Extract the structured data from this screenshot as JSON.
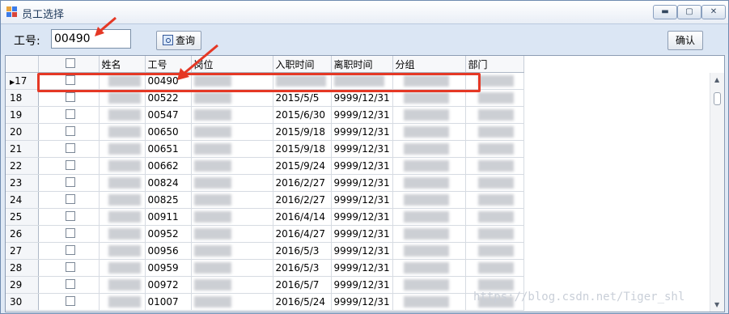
{
  "window": {
    "title": "员工选择",
    "buttons": {
      "minimize": "▬",
      "maximize": "▢",
      "close": "✕"
    }
  },
  "toolbar": {
    "empid_label": "工号:",
    "empid_value": "00490",
    "query_label": "查询",
    "confirm_label": "确认"
  },
  "grid": {
    "columns": [
      "",
      "姓名",
      "工号",
      "岗位",
      "入职时间",
      "离职时间",
      "分组",
      "部门"
    ],
    "rows": [
      {
        "no": "17",
        "id": "00490",
        "start": "",
        "end": "",
        "current": true
      },
      {
        "no": "18",
        "id": "00522",
        "start": "2015/5/5",
        "end": "9999/12/31"
      },
      {
        "no": "19",
        "id": "00547",
        "start": "2015/6/30",
        "end": "9999/12/31"
      },
      {
        "no": "20",
        "id": "00650",
        "start": "2015/9/18",
        "end": "9999/12/31"
      },
      {
        "no": "21",
        "id": "00651",
        "start": "2015/9/18",
        "end": "9999/12/31"
      },
      {
        "no": "22",
        "id": "00662",
        "start": "2015/9/24",
        "end": "9999/12/31"
      },
      {
        "no": "23",
        "id": "00824",
        "start": "2016/2/27",
        "end": "9999/12/31"
      },
      {
        "no": "24",
        "id": "00825",
        "start": "2016/2/27",
        "end": "9999/12/31"
      },
      {
        "no": "25",
        "id": "00911",
        "start": "2016/4/14",
        "end": "9999/12/31"
      },
      {
        "no": "26",
        "id": "00952",
        "start": "2016/4/27",
        "end": "9999/12/31"
      },
      {
        "no": "27",
        "id": "00956",
        "start": "2016/5/3",
        "end": "9999/12/31"
      },
      {
        "no": "28",
        "id": "00959",
        "start": "2016/5/3",
        "end": "9999/12/31"
      },
      {
        "no": "29",
        "id": "00972",
        "start": "2016/5/7",
        "end": "9999/12/31"
      },
      {
        "no": "30",
        "id": "01007",
        "start": "2016/5/24",
        "end": "9999/12/31"
      }
    ]
  },
  "watermark": "https://blog.csdn.net/Tiger_shl",
  "colors": {
    "highlight": "#e53825",
    "titlebar": "#e9eef6",
    "toolbar": "#dbe6f4"
  }
}
